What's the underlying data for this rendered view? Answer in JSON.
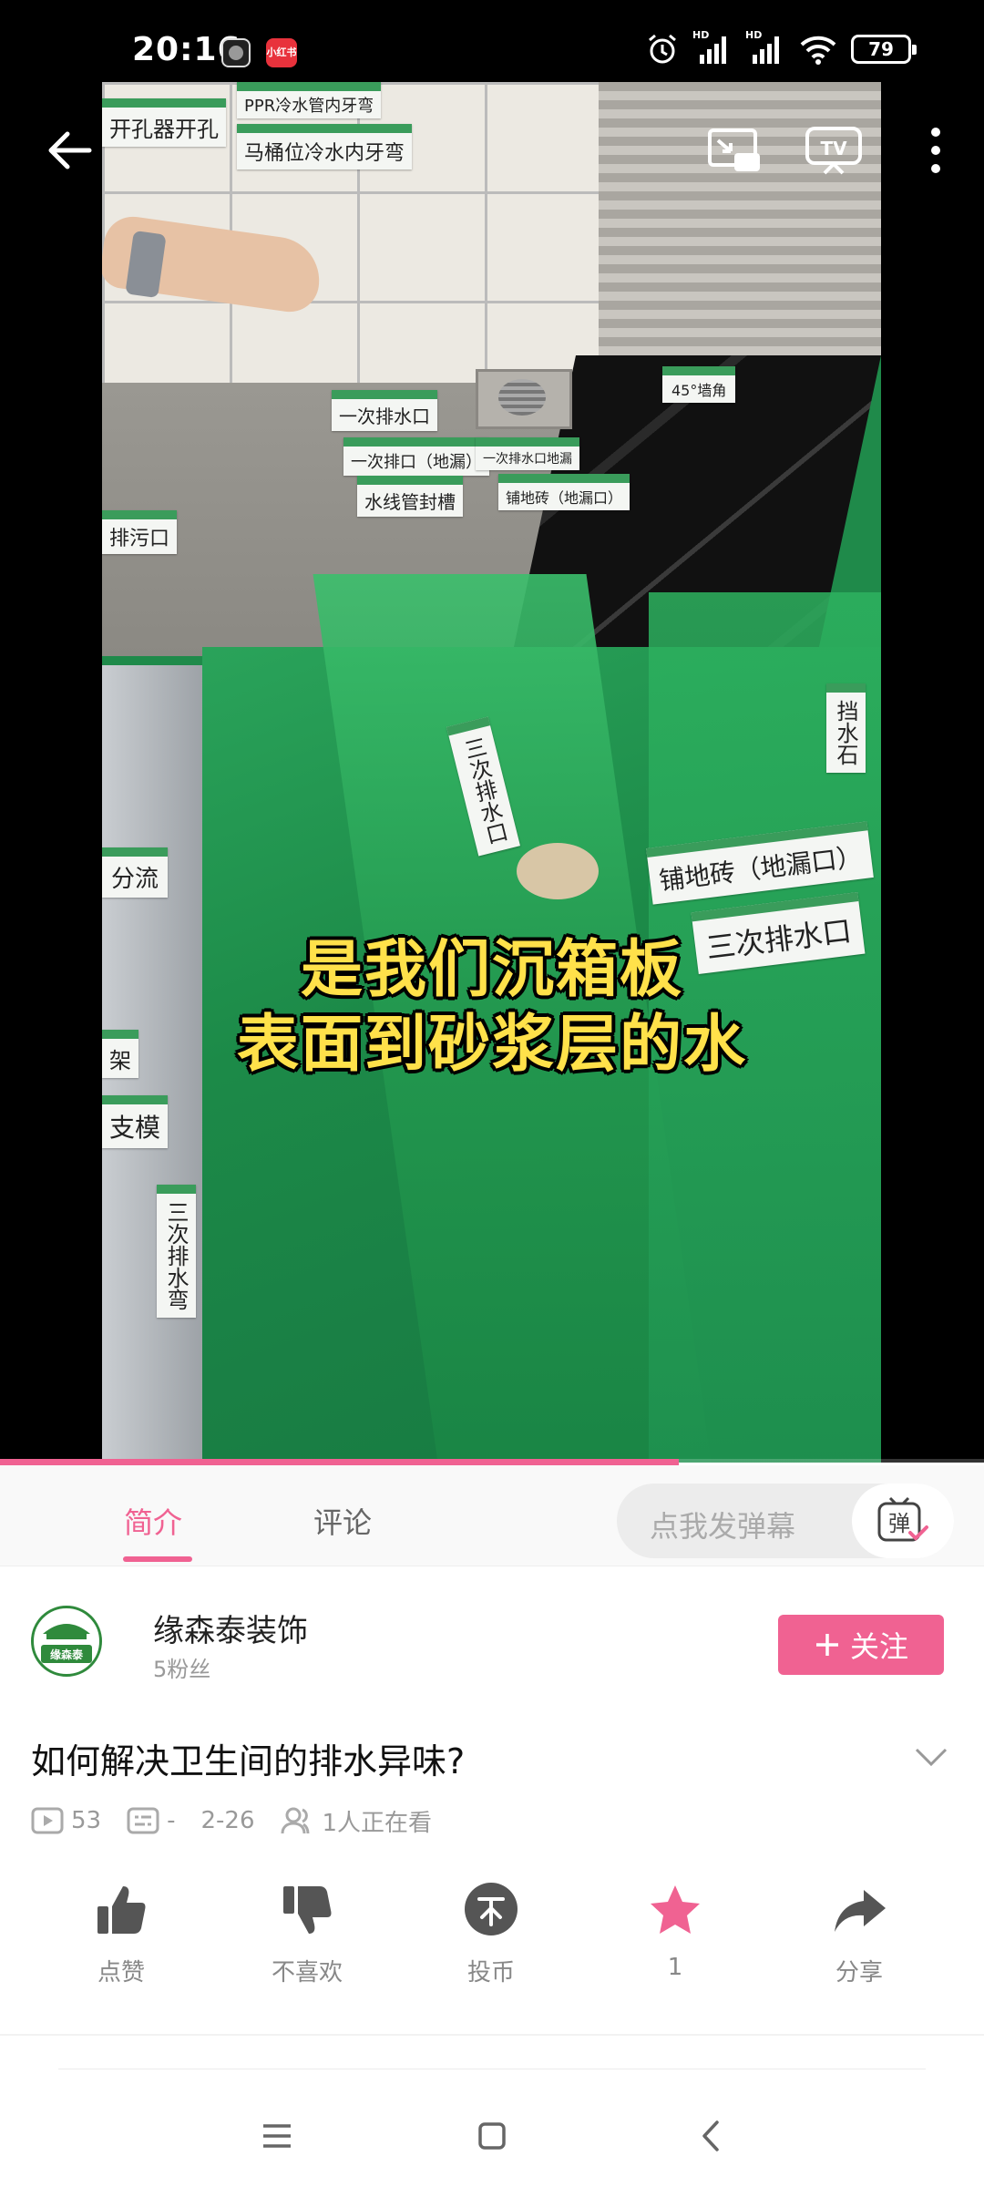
{
  "status_bar": {
    "time": "20:16",
    "app_badge": "小红书",
    "battery": "79",
    "signal1": "HD",
    "signal2": "HD"
  },
  "video": {
    "caption_line1": "是我们沉箱板",
    "caption_line2": "表面到砂浆层的水",
    "progress": 0.69,
    "labels": {
      "t1": "PPR冷水管内牙弯",
      "t2": "开孔器开孔",
      "t3": "马桶位冷水内牙弯",
      "t4": "一次排水口",
      "t5": "一次排口（地漏）",
      "t6": "一次排水口地漏",
      "t7": "水线管封槽",
      "t8": "铺地砖（地漏口）",
      "t9": "45°墙角",
      "t10": "排污口",
      "t11": "三次排水口",
      "t12": "铺地砖（地漏口）",
      "t13": "三次排水口",
      "t14": "分流",
      "t15": "架",
      "t16": "支模",
      "t17": "三次排水弯",
      "t18": "挡水石"
    }
  },
  "tabs": [
    {
      "label": "简介",
      "active": true
    },
    {
      "label": "评论",
      "active": false
    }
  ],
  "danmaku": {
    "placeholder": "点我发弹幕",
    "button": "弹"
  },
  "uploader": {
    "name": "缘森泰装饰",
    "fans": "5粉丝",
    "avatar_text": "缘森泰",
    "follow_label": "关注"
  },
  "video_info": {
    "title": "如何解决卫生间的排水异味?",
    "views": "53",
    "danmaku_count": "-",
    "date": "2-26",
    "watching": "1人正在看"
  },
  "actions": [
    {
      "name": "like",
      "label": "点赞"
    },
    {
      "name": "dislike",
      "label": "不喜欢"
    },
    {
      "name": "coin",
      "label": "投币"
    },
    {
      "name": "favorite",
      "label": "1"
    },
    {
      "name": "share",
      "label": "分享"
    }
  ],
  "colors": {
    "accent": "#f06292",
    "caption": "#ffe14a",
    "green_glass": "#1f8a4a"
  },
  "icons": [
    "back-arrow-icon",
    "cast-icon",
    "tv-icon",
    "more-icon",
    "thumb-up-icon",
    "thumb-down-icon",
    "coin-icon",
    "star-icon",
    "share-icon"
  ]
}
